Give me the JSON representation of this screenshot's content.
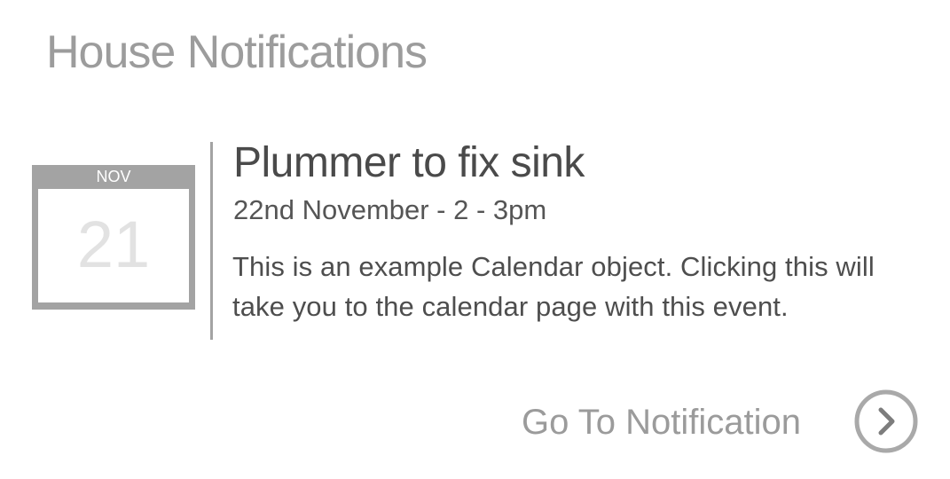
{
  "header": {
    "title": "House Notifications"
  },
  "event": {
    "month": "NOV",
    "day": "21",
    "title": "Plummer to fix sink",
    "time": "22nd November - 2 - 3pm",
    "description": "This is an example Calendar object. Clicking this will take you to the calendar page with this event."
  },
  "action": {
    "label": "Go To Notification",
    "icon": "chevron-right-circle-icon"
  },
  "colors": {
    "title_gray": "#9c9c9c",
    "calendar_frame": "#a3a3a3",
    "calendar_day": "#e2e2e2",
    "text_dark": "#4a4a4a",
    "link_gray": "#9b9b9b"
  }
}
